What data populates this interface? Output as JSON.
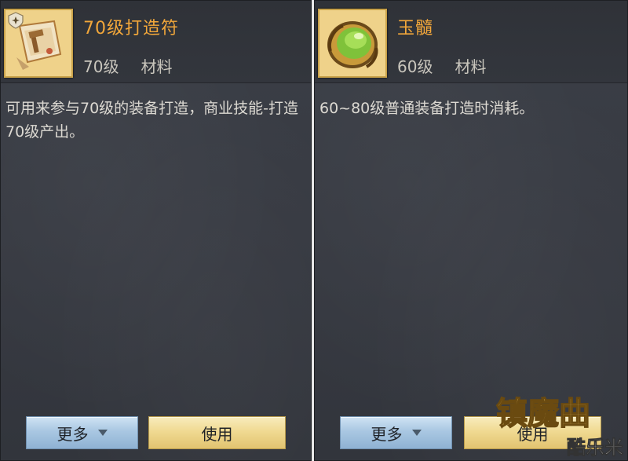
{
  "left_item": {
    "name": "70级打造符",
    "level": "70级",
    "type": "材料",
    "description": "可用来参与70级的装备打造，商业技能-打造70级产出。",
    "icon": "scroll-icon",
    "more_label": "更多",
    "use_label": "使用"
  },
  "right_item": {
    "name": "玉髓",
    "level": "60级",
    "type": "材料",
    "description": "60~80级普通装备打造时消耗。",
    "icon": "green-gem-icon",
    "more_label": "更多",
    "use_label": "使用"
  },
  "watermark": {
    "logo_text": "镇魔曲",
    "site_text": "酷乐米"
  },
  "colors": {
    "name_color": "#f2a73a",
    "icon_frame": "#c9a24a",
    "more_button": "#a9c7e2",
    "use_button": "#f0da92"
  }
}
